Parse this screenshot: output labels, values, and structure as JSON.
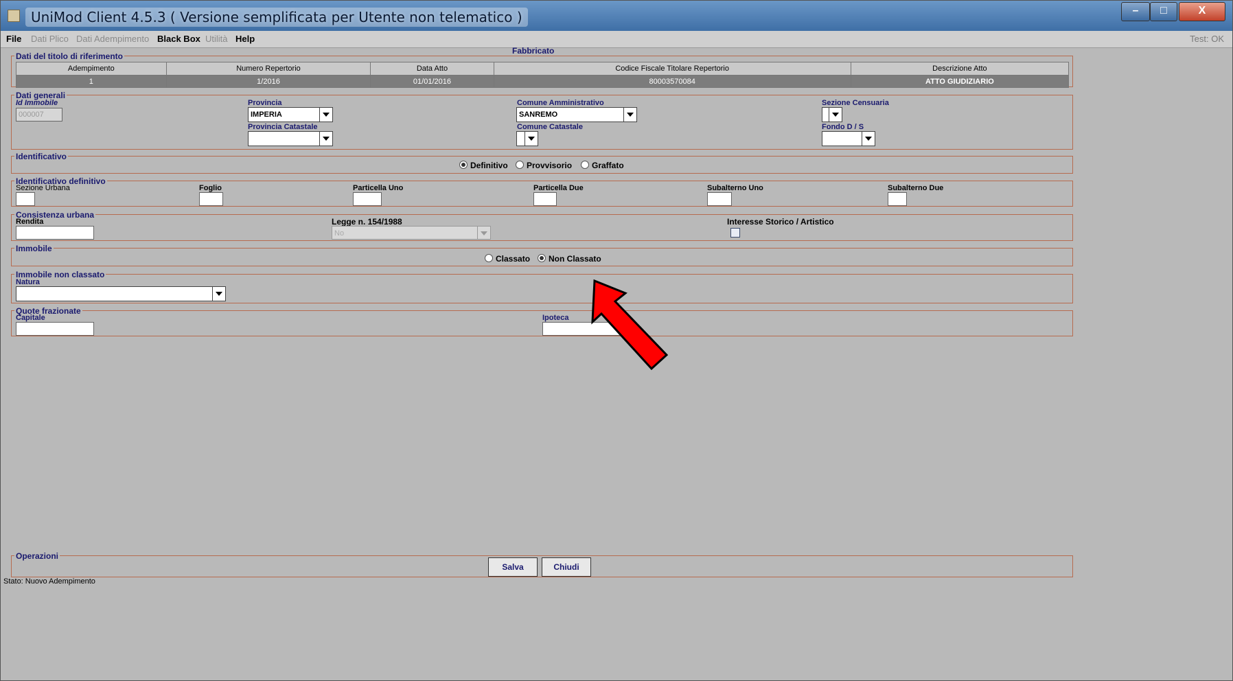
{
  "window": {
    "title": "UniMod Client  4.5.3  ( Versione semplificata per Utente non telematico )"
  },
  "menu": {
    "file": "File",
    "dati_plico": "Dati Plico",
    "dati_adempimento": "Dati Adempimento",
    "black_box": "Black Box",
    "utilita": "Utilità",
    "help": "Help",
    "test": "Test: OK"
  },
  "panel_title": "Fabbricato",
  "titolo": {
    "section": "Dati del titolo di riferimento",
    "headers": [
      "Adempimento",
      "Numero Repertorio",
      "Data Atto",
      "Codice Fiscale Titolare Repertorio",
      "Descrizione Atto"
    ],
    "row": [
      "1",
      "1/2016",
      "01/01/2016",
      "80003570084",
      "ATTO GIUDIZIARIO"
    ]
  },
  "dati_generali": {
    "section": "Dati generali",
    "id_immobile_label": "Id Immobile",
    "id_immobile_value": "000007",
    "provincia_label": "Provincia",
    "provincia_value": "IMPERIA",
    "comune_amm_label": "Comune Amministrativo",
    "comune_amm_value": "SANREMO",
    "sezione_censuaria_label": "Sezione Censuaria",
    "provincia_catastale_label": "Provincia Catastale",
    "comune_catastale_label": "Comune Catastale",
    "fondo_label": "Fondo D / S"
  },
  "identificativo": {
    "section": "Identificativo",
    "options": [
      "Definitivo",
      "Provvisorio",
      "Graffato"
    ]
  },
  "identificativo_definitivo": {
    "section": "Identificativo definitivo",
    "fields": [
      "Sezione Urbana",
      "Foglio",
      "Particella Uno",
      "Particella Due",
      "Subalterno Uno",
      "Subalterno Due"
    ]
  },
  "consistenza": {
    "section": "Consistenza urbana",
    "rendita_label": "Rendita",
    "legge_label": "Legge n. 154/1988",
    "legge_value": "No",
    "interesse_label": "Interesse Storico / Artistico"
  },
  "immobile": {
    "section": "Immobile",
    "options": [
      "Classato",
      "Non Classato"
    ]
  },
  "non_classato": {
    "section": "Immobile non classato",
    "natura_label": "Natura"
  },
  "quote": {
    "section": "Quote frazionate",
    "capitale_label": "Capitale",
    "ipoteca_label": "Ipoteca"
  },
  "operazioni": {
    "section": "Operazioni",
    "salva": "Salva",
    "chiudi": "Chiudi"
  },
  "status": "Stato: Nuovo Adempimento",
  "colors": {
    "border": "#b66b4f",
    "label_blue": "#1a1a6e",
    "arrow": "#ff0000"
  }
}
